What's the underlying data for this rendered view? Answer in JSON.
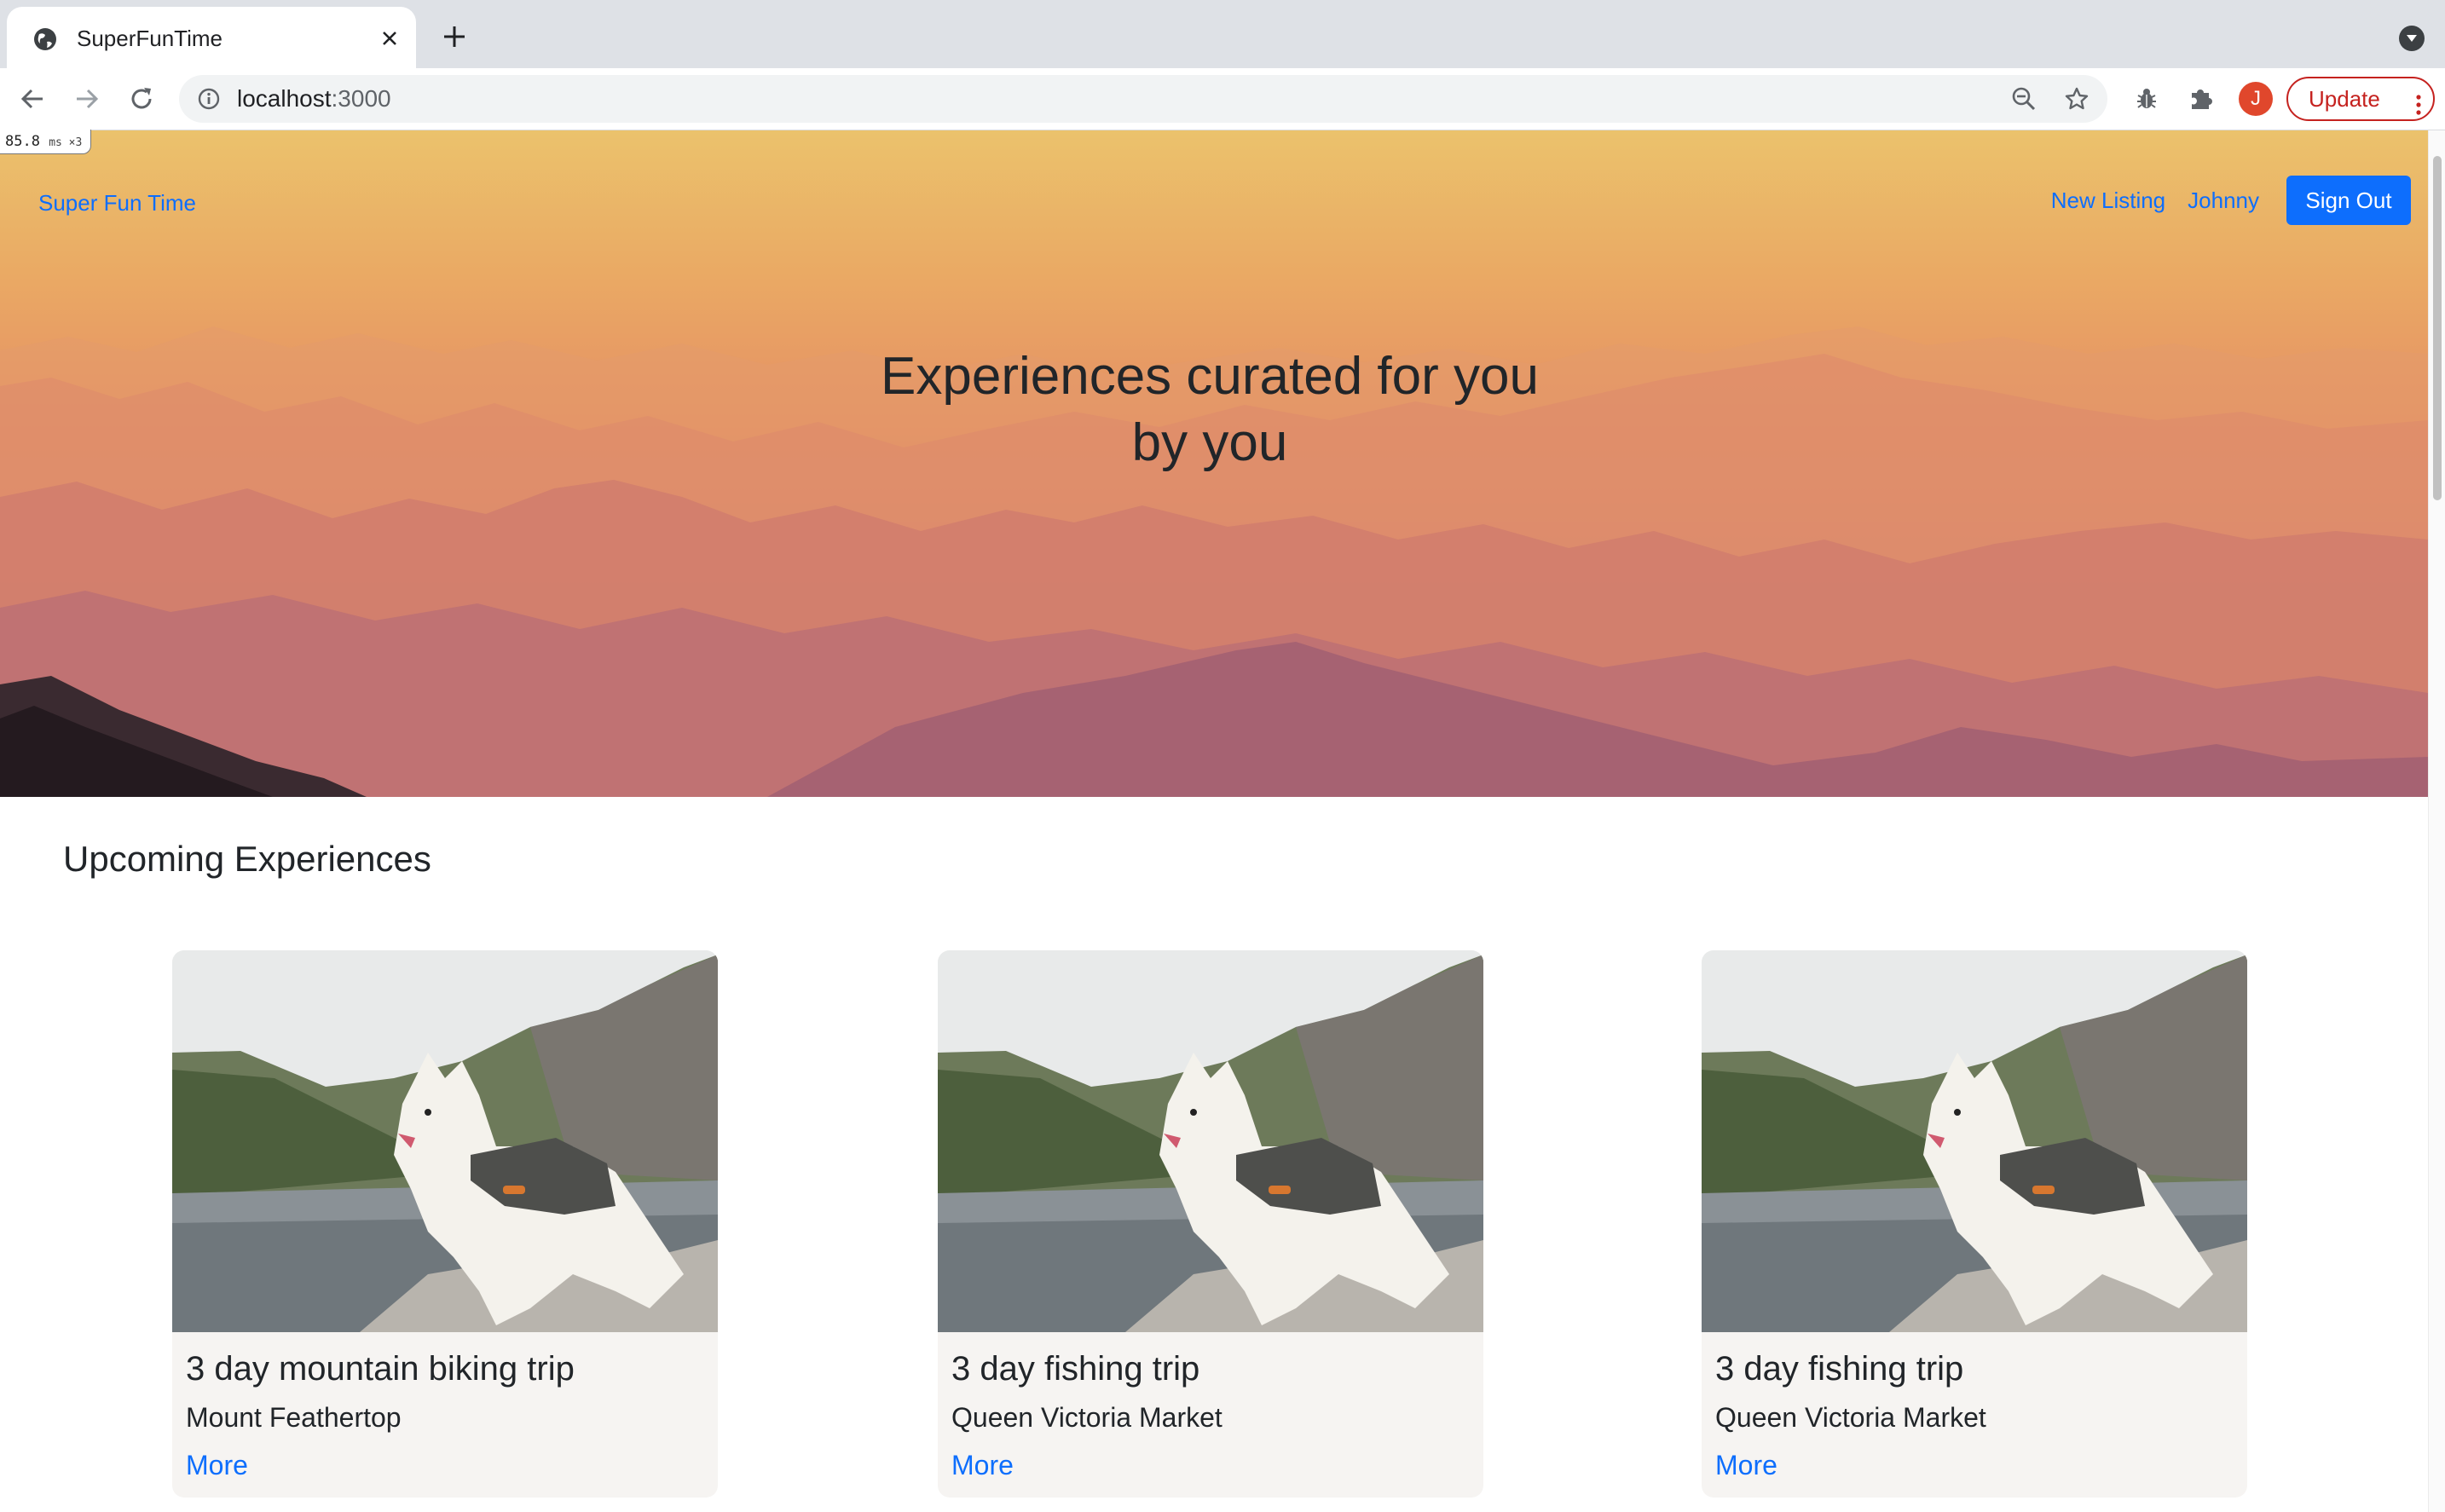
{
  "browser": {
    "tab_title": "SuperFunTime",
    "url_host": "localhost",
    "url_port": ":3000",
    "profile_initial": "J",
    "update_label": "Update",
    "perf_badge": "85.8",
    "perf_badge_unit": "ms ×3"
  },
  "nav": {
    "brand": "Super Fun Time",
    "new_listing": "New Listing",
    "user": "Johnny",
    "sign_out": "Sign Out"
  },
  "hero": {
    "title_line1": "Experiences curated for you",
    "title_line2": "by you"
  },
  "section": {
    "title": "Upcoming Experiences"
  },
  "cards": [
    {
      "title": "3 day mountain biking trip",
      "location": "Mount Feathertop",
      "more": "More"
    },
    {
      "title": "3 day fishing trip",
      "location": "Queen Victoria Market",
      "more": "More"
    },
    {
      "title": "3 day fishing trip",
      "location": "Queen Victoria Market",
      "more": "More"
    }
  ],
  "colors": {
    "accent": "#0d6efd",
    "browser_chrome": "#dee1e6",
    "update_red": "#c5221f",
    "card_bg": "#f6f4f2"
  },
  "icons": [
    "globe-icon",
    "close-icon",
    "plus-icon",
    "chevron-down-icon",
    "back-arrow-icon",
    "forward-arrow-icon",
    "reload-icon",
    "info-icon",
    "zoom-out-icon",
    "star-icon",
    "bug-icon",
    "puzzle-icon",
    "more-vert-icon"
  ]
}
